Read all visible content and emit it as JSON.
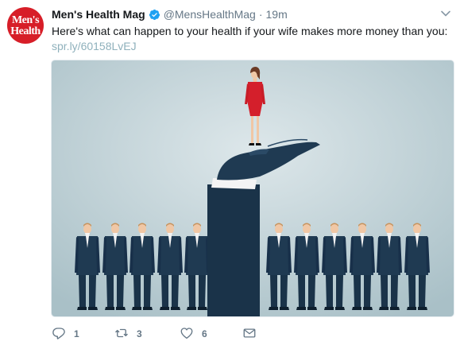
{
  "tweet": {
    "avatar": {
      "line1": "Men's",
      "line2": "Health",
      "color": "#d71e28"
    },
    "display_name": "Men's Health Mag",
    "handle": "@MensHealthMag",
    "separator": "·",
    "time": "19m",
    "text": "Here's what can happen to your health if your wife makes more money than you:",
    "link": "spr.ly/60158LvEJ",
    "icons": {
      "verified": "verified-badge-icon",
      "caret": "chevron-down-icon",
      "reply": "reply-icon",
      "retweet": "retweet-icon",
      "like": "heart-icon",
      "dm": "envelope-icon"
    },
    "actions": {
      "reply_count": "1",
      "retweet_count": "3",
      "like_count": "6"
    }
  },
  "colors": {
    "verified": "#1da1f2",
    "link": "#8fb1bc",
    "muted": "#657786",
    "suit": "#1f3a52",
    "dress": "#d41f2b",
    "background": "#bcd0d6"
  }
}
